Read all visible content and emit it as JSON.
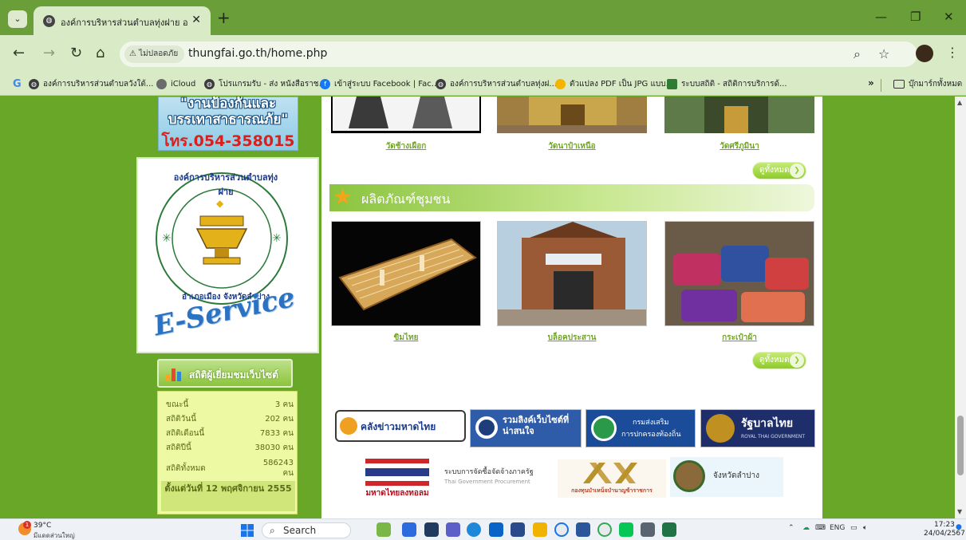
{
  "browser": {
    "tab": {
      "title": "องค์การบริหารส่วนตำบลทุ่งฝาย อ.เมืองลำปาง"
    },
    "address": {
      "security_label": "ไม่ปลอดภัย",
      "url": "thungfai.go.th/home.php"
    },
    "bookmarks": [
      {
        "label": "องค์การบริหารส่วนตำบลวังใต้...",
        "color": "#3c3c3c"
      },
      {
        "label": "iCloud",
        "color": "#6b6b6b"
      },
      {
        "label": "โปรแกรมรับ - ส่ง หนังสือราช...",
        "color": "#3c3c3c"
      },
      {
        "label": "เข้าสู่ระบบ Facebook | Fac...",
        "color": "#1877f2"
      },
      {
        "label": "องค์การบริหารส่วนตำบลทุ่งฝ...",
        "color": "#3c3c3c"
      },
      {
        "label": "ตัวแปลง PDF เป็น JPG แบบ...",
        "color": "#f4b400"
      },
      {
        "label": "ระบบสถิติ - สถิติการบริการด้...",
        "color": "#2e7d32"
      }
    ],
    "bookmarks_more": "»",
    "all_bookmarks": "บุ๊กมาร์กทั้งหมด"
  },
  "sidebar": {
    "hotline_text": "\"งานป้องกันและบรรเทาสาธารณภัย\"",
    "hotline_phone": "โทร.054-358015",
    "eservice": {
      "seal_text": "องค์การบริหารส่วนตำบลทุ่งฝาย",
      "district_text": "อำเภอเมือง จังหวัดลำปาง",
      "label": "E-Service"
    },
    "stats": {
      "title": "สถิติผู้เยี่ยมชมเว็บไซต์",
      "rows": [
        {
          "label": "ขณะนี้",
          "value": "3 คน"
        },
        {
          "label": "สถิติวันนี้",
          "value": "202 คน"
        },
        {
          "label": "สถิติเดือนนี้",
          "value": "7833 คน"
        },
        {
          "label": "สถิติปีนี้",
          "value": "38030 คน"
        },
        {
          "label": "สถิติทั้งหมด",
          "value": "586243 คน"
        }
      ],
      "since": "ตั้งแต่วันที่ 12 พฤศจิกายน 2555"
    }
  },
  "temples": [
    {
      "name": "วัดช้างเผือก"
    },
    {
      "name": "วัดนาป๋าเหนือ"
    },
    {
      "name": "วัดศรีภูมินา"
    }
  ],
  "see_all_label": "ดูทั้งหมด",
  "products": {
    "title": "ผลิตภัณฑ์ชุมชน",
    "items": [
      {
        "name": "ขิมไทย"
      },
      {
        "name": "บล็อคประสาน"
      },
      {
        "name": "กระเป๋าผ้า"
      }
    ]
  },
  "banners": {
    "news": "คลังข่าวมหาดไทย",
    "links": "รวมลิงค์เว็บไซต์ที่น่าสนใจ",
    "dla_1": "กรมส่งเสริม",
    "dla_2": "การปกครองท้องถิ่น",
    "thaigov": "รัฐบาลไทย",
    "thaigov_sub": "ROYAL THAI GOVERNMENT",
    "lottery": "มหาดไทยลงทอลม",
    "egp_th": "ระบบการจัดซื้อจัดจ้างภาครัฐ",
    "egp_en": "Thai Government Procurement",
    "pension": "กองทุนบำเหน็จบำนาญข้าราชการ",
    "lampang": "จังหวัดลำปาง"
  },
  "taskbar": {
    "temp": "39°C",
    "weather": "มีแดดส่วนใหญ่",
    "search": "Search",
    "lang": "ENG",
    "time": "17:23",
    "date": "24/04/2567"
  }
}
